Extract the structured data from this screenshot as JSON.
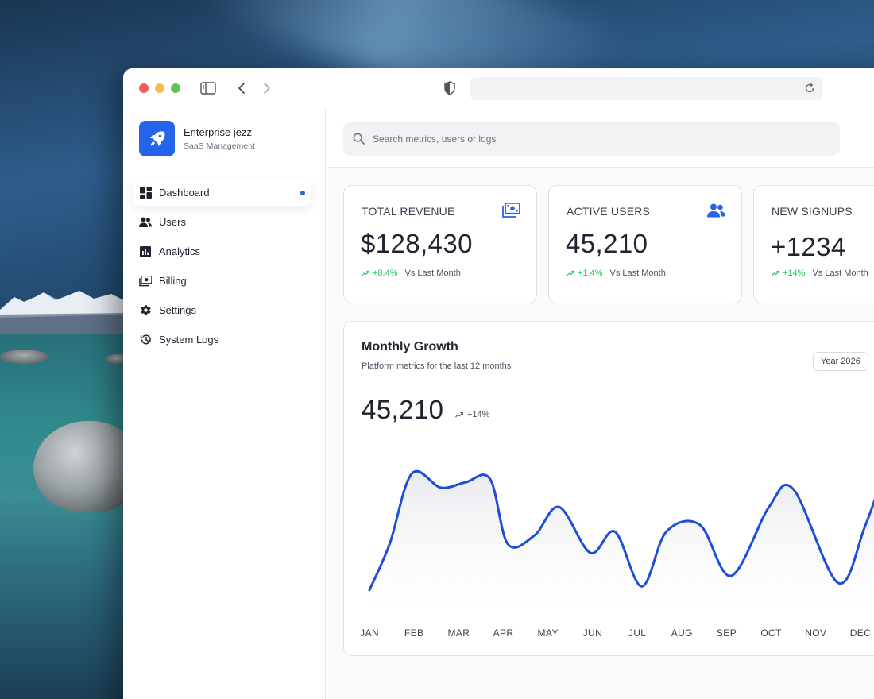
{
  "brand": {
    "title": "Enterprise jezz",
    "subtitle": "SaaS Management"
  },
  "nav": [
    {
      "label": "Dashboard",
      "icon": "dashboard-icon",
      "active": true
    },
    {
      "label": "Users",
      "icon": "users-icon"
    },
    {
      "label": "Analytics",
      "icon": "analytics-icon"
    },
    {
      "label": "Billing",
      "icon": "billing-icon"
    },
    {
      "label": "Settings",
      "icon": "gear-icon"
    },
    {
      "label": "System Logs",
      "icon": "history-icon"
    }
  ],
  "search": {
    "placeholder": "Search metrics, users or logs"
  },
  "stats": [
    {
      "label": "TOTAL REVENUE",
      "value": "$128,430",
      "change": "+8.4%",
      "compare": "Vs Last Month",
      "icon": "money-icon"
    },
    {
      "label": "ACTIVE USERS",
      "value": "45,210",
      "change": "+1.4%",
      "compare": "Vs Last Month",
      "icon": "users-icon"
    },
    {
      "label": "NEW SIGNUPS",
      "value": "+1234",
      "change": "+14%",
      "compare": "Vs Last Month"
    }
  ],
  "growth": {
    "title": "Monthly Growth",
    "subtitle": "Platform metrics for the last 12 months",
    "year_label": "Year 2026",
    "value": "45,210",
    "change": "+14%"
  },
  "colors": {
    "accent": "#2563eb",
    "positive": "#22c55e",
    "line": "#1d4ed8"
  },
  "chart_data": {
    "type": "area",
    "categories": [
      "JAN",
      "FEB",
      "MAR",
      "APR",
      "MAY",
      "JUN",
      "JUL",
      "AUG",
      "SEP",
      "OCT",
      "NOV",
      "DEC"
    ],
    "smooth": true,
    "grid": false,
    "series": [
      {
        "x": [
          0,
          0.45,
          0.95,
          1.6,
          2.15,
          2.7,
          3.1,
          3.7,
          4.25,
          4.95,
          5.5,
          6.1,
          6.65,
          7.4,
          8.1,
          8.95,
          9.5,
          10.5,
          11.1,
          11.6
        ],
        "values": [
          1,
          3.6,
          7.6,
          6.8,
          7.1,
          7.3,
          3.6,
          4.1,
          5.7,
          3.1,
          4.3,
          1.2,
          4.3,
          4.7,
          1.8,
          5.7,
          6.7,
          1.4,
          4.6,
          8.2
        ]
      }
    ]
  }
}
